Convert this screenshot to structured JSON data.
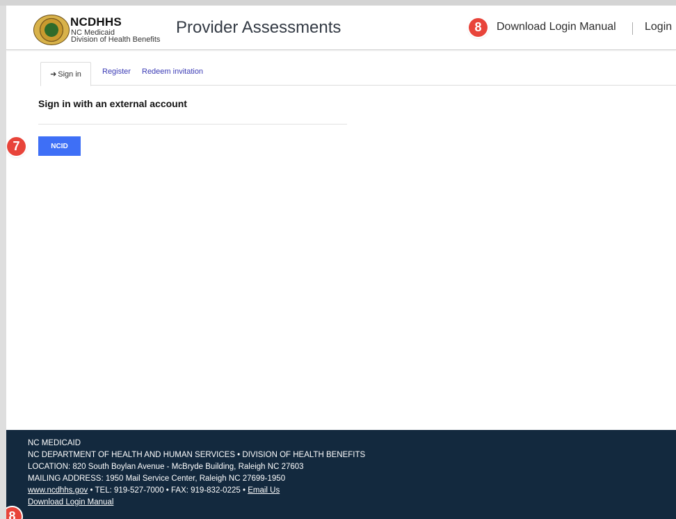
{
  "header": {
    "brand_name": "NCDHHS",
    "brand_sub1": "NC Medicaid",
    "brand_sub2": "Division of Health Benefits",
    "site_title": "Provider Assessments",
    "callout_badge": "8",
    "download_label": "Download Login Manual",
    "separator": "|",
    "login_label": "Login"
  },
  "tabs": {
    "signin_icon": "➜",
    "signin_label": "Sign in",
    "register_label": "Register",
    "redeem_label": "Redeem invitation"
  },
  "main": {
    "section_title": "Sign in with an external account",
    "ncid_badge": "7",
    "ncid_label": "NCID"
  },
  "footer": {
    "line1": "NC MEDICAID",
    "line2": "NC DEPARTMENT OF HEALTH AND HUMAN SERVICES • DIVISION OF HEALTH BENEFITS",
    "line3": "LOCATION: 820 South Boylan Avenue - McBryde Building, Raleigh NC 27603",
    "line4": "MAILING ADDRESS: 1950 Mail Service Center, Raleigh NC 27699-1950",
    "website_link": "www.ncdhhs.gov",
    "contact_text": " • TEL: 919-527-7000 • FAX: 919-832-0225 • ",
    "email_link": "Email Us",
    "download_link": "Download Login Manual",
    "callout_badge": "8"
  },
  "colors": {
    "primary_button": "#3e6ff6",
    "footer_bg": "#13293e",
    "callout_badge": "#e8443a",
    "tab_link": "#3a3ab5"
  },
  "icons": [
    "seal-logo-icon",
    "sign-in-icon"
  ]
}
